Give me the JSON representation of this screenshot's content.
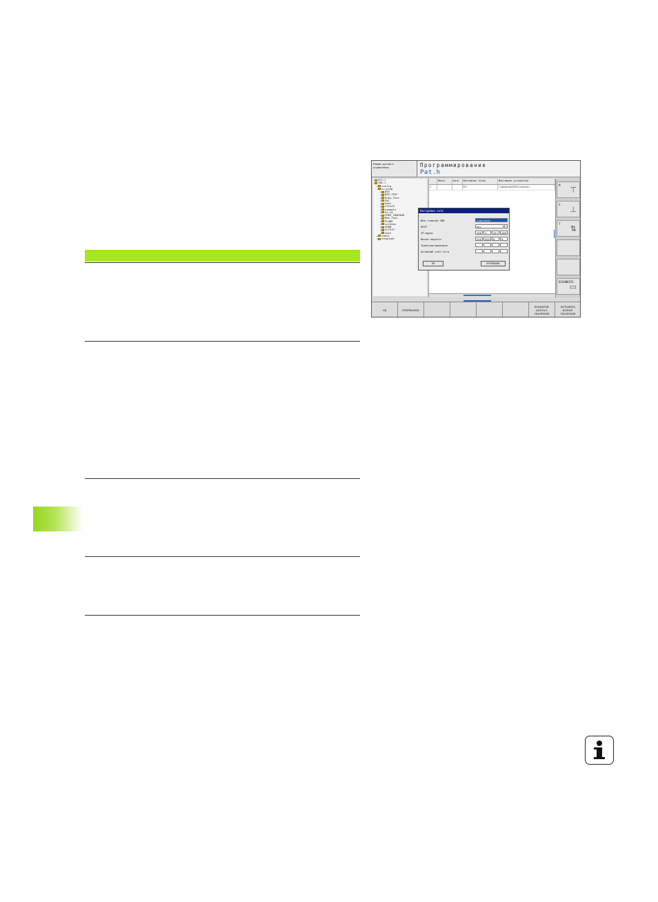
{
  "screen": {
    "mode_label": "Режим ручного\nуправления",
    "title_mode": "Программирование",
    "title_program": "Pat.h",
    "tree": [
      {
        "label": "PLC:\\",
        "depth": 0,
        "exp": "-"
      },
      {
        "label": "TNC:\\",
        "depth": 0,
        "exp": "-"
      },
      {
        "label": "config",
        "depth": 1,
        "exp": "+"
      },
      {
        "label": "nc_prog",
        "depth": 1,
        "exp": "-"
      },
      {
        "label": "DSX",
        "depth": 2,
        "exp": "+"
      },
      {
        "label": "DSX-TEST",
        "depth": 2,
        "exp": "+"
      },
      {
        "label": "Duto_Test",
        "depth": 2,
        "exp": "+"
      },
      {
        "label": "CKC",
        "depth": 2,
        "exp": "+"
      },
      {
        "label": "Cmst",
        "depth": 2,
        "exp": "+"
      },
      {
        "label": "CYCLES",
        "depth": 2,
        "exp": "+"
      },
      {
        "label": "example",
        "depth": 2,
        "exp": "+"
      },
      {
        "label": "Fk-sk",
        "depth": 2,
        "exp": "+"
      },
      {
        "label": "FREE_CONTOUR",
        "depth": 2,
        "exp": "+"
      },
      {
        "label": "Man_Test",
        "depth": 2,
        "exp": "+"
      },
      {
        "label": "PLANE",
        "depth": 2,
        "exp": "+"
      },
      {
        "label": "screens",
        "depth": 2,
        "exp": "+"
      },
      {
        "label": "SHOW",
        "depth": 2,
        "exp": "+"
      },
      {
        "label": "SLTEST",
        "depth": 2,
        "exp": "+"
      },
      {
        "label": "test",
        "depth": 2,
        "exp": "+"
      },
      {
        "label": "table",
        "depth": 1,
        "exp": "+"
      },
      {
        "label": "tncguide",
        "depth": 1,
        "exp": "+"
      }
    ],
    "file_table": {
      "headers": [
        "",
        "Mount",
        "авто",
        "Монтажная точка",
        "Монтажное устройство"
      ],
      "rows": [
        [
          "1",
          "",
          "",
          "PC:",
          "\\\\deAlock333\\transfer"
        ]
      ]
    },
    "right_softkeys": [
      {
        "label": "M",
        "icon": "tool-icon"
      },
      {
        "label": "S",
        "icon": "spindle-icon"
      },
      {
        "label": "T",
        "icon": "arrows-icon"
      },
      {
        "label": "",
        "icon": ""
      },
      {
        "label": "",
        "icon": ""
      },
      {
        "label": "DIAGNOSIS",
        "icon": "folder-icon"
      }
    ],
    "dialog": {
      "title": "Настройка сети",
      "fields": [
        {
          "label": "Имя главной ЭВМ",
          "value": "simulator"
        },
        {
          "label": "DHCP",
          "value": "нет"
        },
        {
          "label": "IP-адрес",
          "values": [
            "160",
            "1",
            "247",
            "208"
          ]
        },
        {
          "label": "Маска подсети",
          "values": [
            "255",
            "255",
            "0",
            "0"
          ]
        },
        {
          "label": "Транспортирование",
          "values": [
            "",
            "",
            "",
            ""
          ]
        },
        {
          "label": "Активный узел сети",
          "values": [
            "",
            "",
            "",
            ""
          ]
        }
      ],
      "ok_label": "ОК",
      "cancel_label": "ПРЕРВАНИЕ"
    },
    "bottom_softkeys": [
      "ОК",
      "ПРЕРВАНИЕ",
      "",
      "",
      "",
      "",
      "НОМИРОВ.\nАКТУАЛ.\nЗНАЧЕНИЕ",
      "ВСТАВИТЬ\nКОПИР.\nЗНАЧЕНИЕ"
    ]
  }
}
